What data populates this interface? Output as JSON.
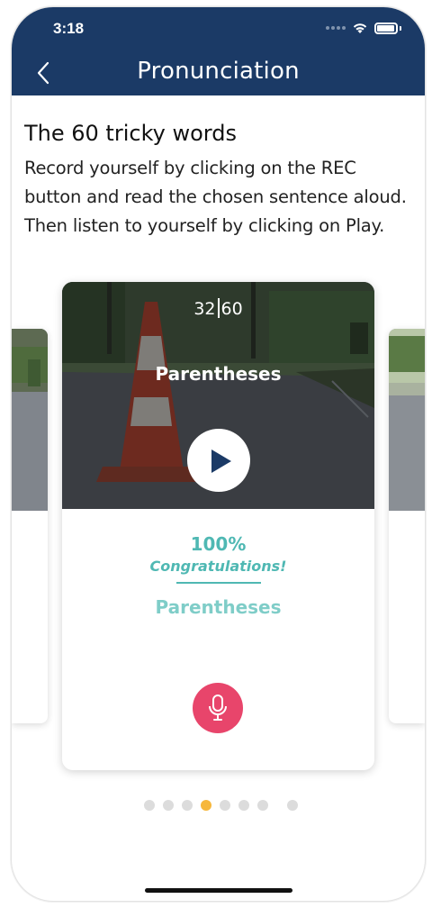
{
  "status_bar": {
    "time": "3:18"
  },
  "nav": {
    "title": "Pronunciation",
    "back_icon": "chevron-left-icon"
  },
  "content": {
    "title": "The 60 tricky words",
    "description": "Record yourself by clicking on the REC button and read the chosen sentence aloud. Then listen to yourself by clicking on Play."
  },
  "card": {
    "counter_current": "32",
    "counter_total": "60",
    "word": "Parentheses",
    "score": "100%",
    "feedback": "Congratulations!",
    "recognized_word": "Parentheses"
  },
  "pagination": {
    "total_visible": 8,
    "active_index": 3
  },
  "colors": {
    "nav_bg": "#1b3a66",
    "accent_teal": "#4fb8b3",
    "record_red": "#e8456b",
    "active_dot": "#f6b73c"
  }
}
